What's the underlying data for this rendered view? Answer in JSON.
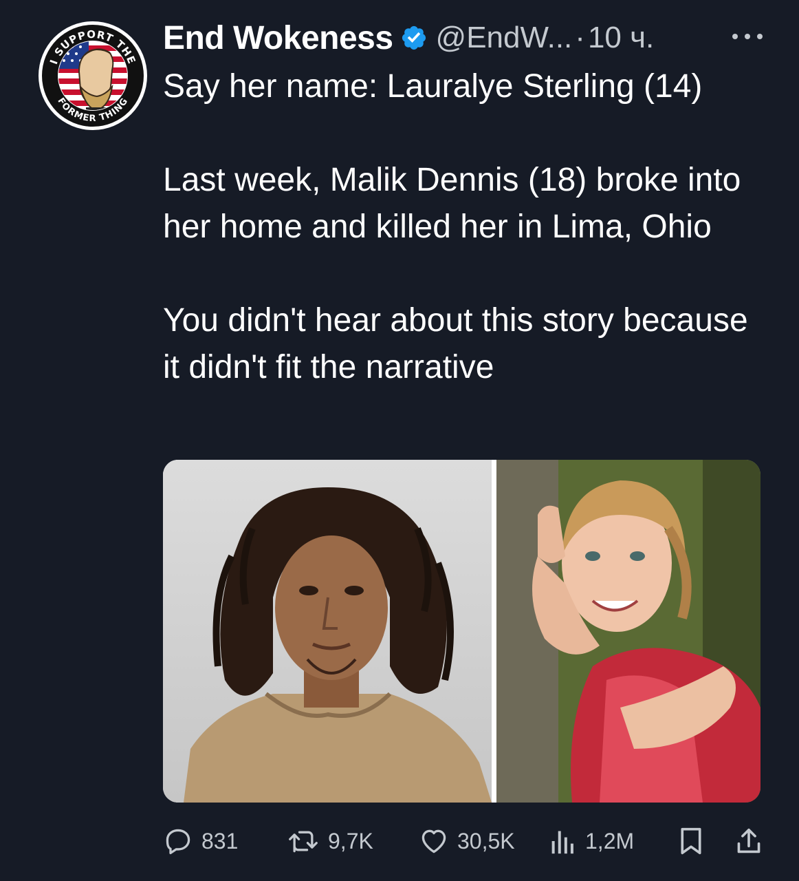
{
  "tweet": {
    "display_name": "End Wokeness",
    "handle": "@EndW...",
    "separator": "·",
    "time": "10 ч.",
    "text": {
      "line1": "Say her name: Lauralye Sterling (14)",
      "para2": "Last week, Malik Dennis (18) broke into her home and killed her in Lima, Ohio",
      "para3": "You didn't hear about this story because it didn't fit the narrative"
    },
    "avatar": {
      "badge_top_text": "I SUPPORT THE",
      "badge_bottom_text": "FORMER THING"
    },
    "media": [
      {
        "icon": "mugshot-photo"
      },
      {
        "icon": "portrait-photo"
      }
    ]
  },
  "actions": {
    "replies": "831",
    "retweets": "9,7K",
    "likes": "30,5K",
    "views": "1,2M"
  },
  "colors": {
    "background": "#161b26",
    "text": "#ffffff",
    "secondary": "#c4c9cf",
    "verified": "#1d9bf0"
  }
}
